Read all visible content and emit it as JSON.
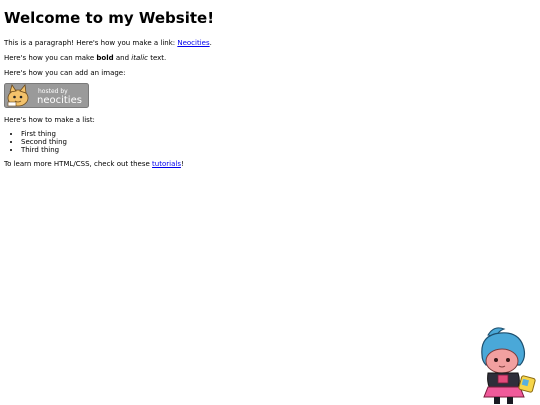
{
  "page": {
    "heading": "Welcome to my Website!",
    "paragraph": {
      "before_link": "This is a paragraph! Here's how you make a link: ",
      "link_text": "Neocities",
      "after_link": "."
    },
    "formatting": {
      "before_bold": "Here's how you can make ",
      "bold_text": "bold",
      "between": " and ",
      "italic_text": "italic",
      "after_italic": " text."
    },
    "image_intro": "Here's how you can add an image:",
    "badge": {
      "line1": "hosted by",
      "line2": "neocities"
    },
    "list_intro": "Here's how to make a list:",
    "list_items": [
      "First thing",
      "Second thing",
      "Third thing"
    ],
    "learn_more": {
      "before_link": "To learn more HTML/CSS, check out these ",
      "link_text": "tutorials",
      "after_link": "!"
    }
  },
  "colors": {
    "link": "#0000ee",
    "badge_bg": "#9a9a9a",
    "mascot_hair": "#4aa8d8",
    "mascot_skin": "#f2a0a0"
  },
  "icons": {
    "badge_mascot": "neocities-cat-icon",
    "corner_mascot": "cookie-character-icon"
  }
}
